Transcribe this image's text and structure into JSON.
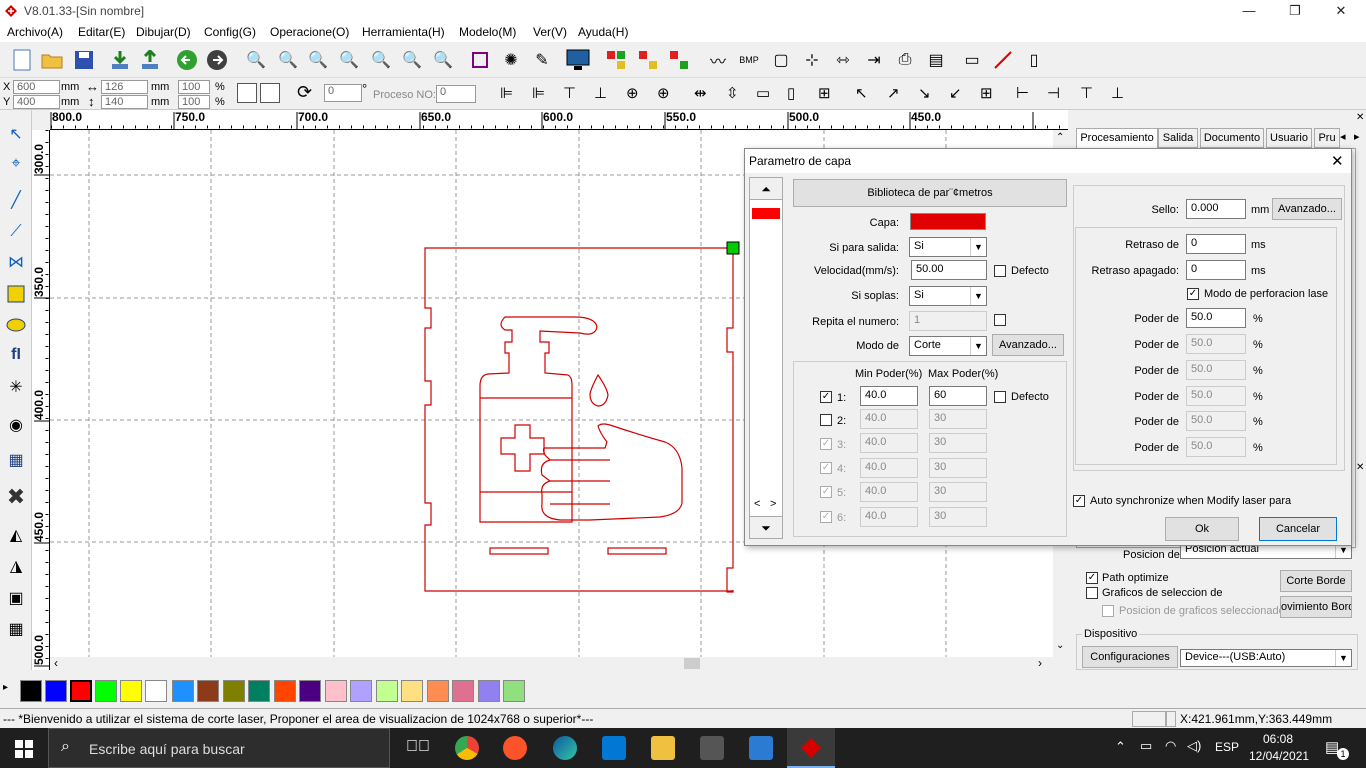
{
  "window": {
    "title": "V8.01.33-[Sin nombre]"
  },
  "menu": [
    "Archivo(A)",
    "Editar(E)",
    "Dibujar(D)",
    "Config(G)",
    "Operacione(O)",
    "Herramienta(H)",
    "Modelo(M)",
    "Ver(V)",
    "Ayuda(H)"
  ],
  "toolbar2": {
    "x_label": "X",
    "x_value": "600",
    "x_unit": "mm",
    "y_label": "Y",
    "y_value": "400",
    "y_unit": "mm",
    "w_value": "126",
    "w_unit": "mm",
    "h_value": "140",
    "h_unit": "mm",
    "pct1": "100",
    "pct2": "100",
    "pct_sign": "%",
    "rotate_value": "0",
    "degree": "°",
    "proceso_label": "Proceso NO:",
    "proceso_value": "0"
  },
  "ruler": {
    "h_ticks": [
      "800.0",
      "750.0",
      "700.0",
      "650.0",
      "600.0",
      "550.0",
      "500.0",
      "450.0"
    ],
    "v_ticks": [
      "300.0",
      "350.0",
      "400.0",
      "450.0",
      "500.0"
    ]
  },
  "right_panel": {
    "tabs": [
      "Procesamiento",
      "Salida",
      "Documento",
      "Usuario",
      "Pru"
    ],
    "posicion_label": "Posicion de",
    "posicion_value": "Posicion actual",
    "path_optimize": "Path optimize",
    "graficos_label": "Graficos de seleccion de",
    "posicion_graficos": "Posicion de graficos seleccionado",
    "corte_borde": "Corte Borde",
    "movimiento_borde": "ovimiento Bord",
    "dispositivo_label": "Dispositivo",
    "configuraciones": "Configuraciones",
    "device_value": "Device---(USB:Auto)"
  },
  "palette": [
    "#000000",
    "#0000ff",
    "#ff0000",
    "#00ff00",
    "#ffff00",
    "#ffffff",
    "#1e90ff",
    "#8b3a1a",
    "#808000",
    "#008060",
    "#ff4500",
    "#4b0082",
    "#ffc0cb",
    "#b0a0ff",
    "#c0ff90",
    "#ffe080",
    "#ff8c50",
    "#e07090",
    "#9080f0",
    "#90e080",
    "#c0a880"
  ],
  "status": {
    "message": "--- *Bienvenido a utilizar el sistema de corte laser, Proponer el area de visualizacion de 1024x768 o superior*---",
    "coords": "X:421.961mm,Y:363.449mm"
  },
  "taskbar": {
    "search_placeholder": "Escribe aquí para buscar",
    "lang": "ESP",
    "time": "06:08",
    "date": "12/04/2021",
    "notif_count": "1"
  },
  "dialog": {
    "title": "Parametro de capa",
    "biblioteca": "Biblioteca de par¨¢metros",
    "capa_label": "Capa:",
    "capa_color": "#ff0000",
    "salida_label": "Si para salida:",
    "salida_value": "Si",
    "velocidad_label": "Velocidad(mm/s):",
    "velocidad_value": "50.00",
    "defecto": "Defecto",
    "soplas_label": "Si soplas:",
    "soplas_value": "Si",
    "repita_label": "Repita el numero:",
    "repita_value": "1",
    "modo_label": "Modo de",
    "modo_value": "Corte",
    "avanzado": "Avanzado...",
    "min_poder": "Min Poder(%)",
    "max_poder": "Max Poder(%)",
    "power_rows": [
      {
        "n": "1:",
        "min": "40.0",
        "max": "60",
        "checked": "✓"
      },
      {
        "n": "2:",
        "min": "40.0",
        "max": "30",
        "checked": ""
      },
      {
        "n": "3:",
        "min": "40.0",
        "max": "30",
        "checked": "✓"
      },
      {
        "n": "4:",
        "min": "40.0",
        "max": "30",
        "checked": "✓"
      },
      {
        "n": "5:",
        "min": "40.0",
        "max": "30",
        "checked": "✓"
      },
      {
        "n": "6:",
        "min": "40.0",
        "max": "30",
        "checked": "✓"
      }
    ],
    "sello_label": "Sello:",
    "sello_value": "0.000",
    "sello_unit": "mm",
    "retraso_de_label": "Retraso de",
    "retraso_de_value": "0",
    "retraso_apagado_label": "Retraso apagado:",
    "retraso_apagado_value": "0",
    "ms": "ms",
    "modo_perforacion": "Modo de perforacion lase",
    "poder_de_label": "Poder de",
    "poder_values": [
      "50.0",
      "50.0",
      "50.0",
      "50.0",
      "50.0",
      "50.0"
    ],
    "pct": "%",
    "auto_sync": "Auto synchronize when Modify laser para",
    "ok": "Ok",
    "cancel": "Cancelar"
  }
}
